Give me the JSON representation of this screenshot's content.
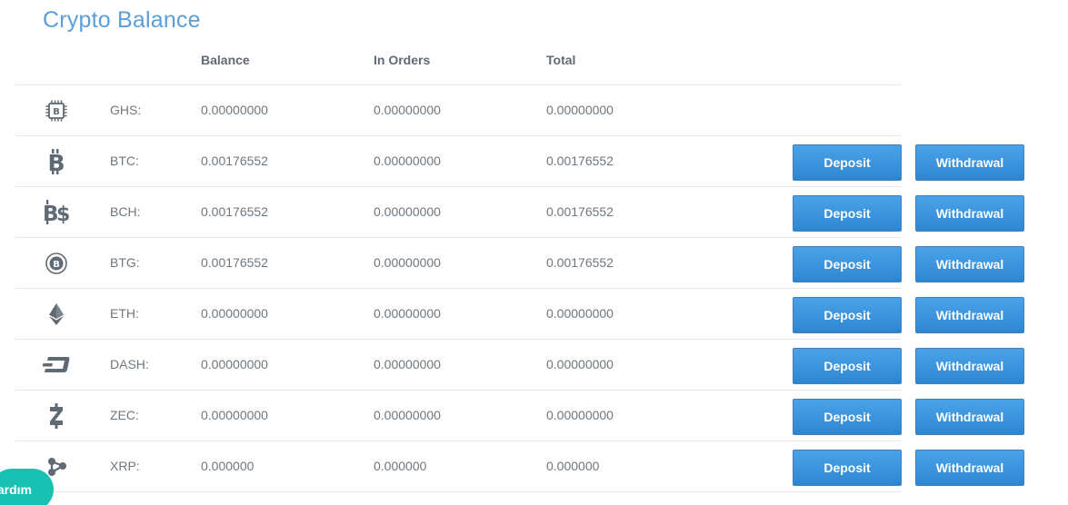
{
  "title": "Crypto Balance",
  "columns": {
    "balance": "Balance",
    "in_orders": "In Orders",
    "total": "Total"
  },
  "rows": [
    {
      "icon": "ghs-chip-icon",
      "symbol": "GHS:",
      "balance": "0.00000000",
      "in_orders": "0.00000000",
      "total": "0.00000000",
      "actions": false
    },
    {
      "icon": "bitcoin-icon",
      "symbol": "BTC:",
      "balance": "0.00176552",
      "in_orders": "0.00000000",
      "total": "0.00176552",
      "actions": true
    },
    {
      "icon": "bitcoin-cash-icon",
      "symbol": "BCH:",
      "balance": "0.00176552",
      "in_orders": "0.00000000",
      "total": "0.00176552",
      "actions": true
    },
    {
      "icon": "bitcoin-gold-icon",
      "symbol": "BTG:",
      "balance": "0.00176552",
      "in_orders": "0.00000000",
      "total": "0.00176552",
      "actions": true
    },
    {
      "icon": "ethereum-icon",
      "symbol": "ETH:",
      "balance": "0.00000000",
      "in_orders": "0.00000000",
      "total": "0.00000000",
      "actions": true
    },
    {
      "icon": "dash-icon",
      "symbol": "DASH:",
      "balance": "0.00000000",
      "in_orders": "0.00000000",
      "total": "0.00000000",
      "actions": true
    },
    {
      "icon": "zcash-icon",
      "symbol": "ZEC:",
      "balance": "0.00000000",
      "in_orders": "0.00000000",
      "total": "0.00000000",
      "actions": true
    },
    {
      "icon": "ripple-icon",
      "symbol": "XRP:",
      "balance": "0.000000",
      "in_orders": "0.000000",
      "total": "0.000000",
      "actions": true
    }
  ],
  "buttons": {
    "deposit": "Deposit",
    "withdrawal": "Withdrawal"
  },
  "help_widget": {
    "label": "ardım"
  },
  "colors": {
    "title": "#5d9ed6",
    "button": "#3590d8",
    "icon": "#5f6a75",
    "help": "#19c1b3"
  }
}
